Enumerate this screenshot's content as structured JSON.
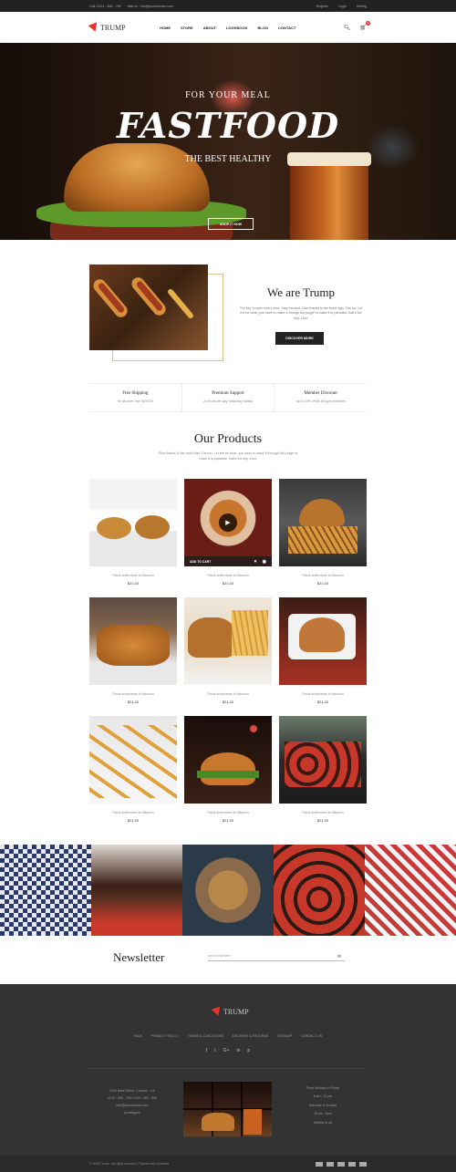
{
  "topbar": {
    "call": "Call: 0123 - 456 - 789",
    "mail": "Mail us : info@yourdomain.com",
    "links": [
      "Register",
      "Login",
      "Setting"
    ]
  },
  "header": {
    "logo_text": "TRUMP",
    "nav": [
      "HOME",
      "STORE",
      "ABOUT",
      "LOOKBOOK",
      "BLOG",
      "CONTACT"
    ],
    "cart_count": "0"
  },
  "hero": {
    "line1": "FOR YOUR MEAL",
    "line2": "FASTFOOD",
    "line3": "THE BEST HEALTHY",
    "button": "SHOP IT NOW"
  },
  "about": {
    "title": "We are Trump",
    "desc": "The key to open every door. Stay focused. Give thanks to the most high. Fan luv. Let me be clear, you have to make it through the jungle to make it to paradise, that's the key. Lion!",
    "button": "DISCOVER MORE"
  },
  "features": [
    {
      "title": "Free Shipping",
      "sub": "for all order over $099.00"
    },
    {
      "title": "Premium Support",
      "sub": "24 hours per day, including holiday"
    },
    {
      "title": "Member Discount",
      "sub": "Up to 20% off for all loyal members"
    }
  ],
  "products": {
    "title": "Our Products",
    "desc": "Give thanks to the most high. Fan luv. Let me be clear, you have to make it through the jungle to make it to paradise, that's the key. Lion!",
    "add_to_cart": "ADD TO CART",
    "items": [
      {
        "name": "Flank sollemnes in futurum",
        "price": "$21.00"
      },
      {
        "name": "Flank sollemnes in futurum",
        "price": "$21.00"
      },
      {
        "name": "Flank sollemnes in futurum",
        "price": "$21.00"
      },
      {
        "name": "Flank sollemnes in futurum",
        "price": "$21.00"
      },
      {
        "name": "Flank sollemnes in futurum",
        "price": "$21.00"
      },
      {
        "name": "Flank sollemnes in futurum",
        "price": "$21.00"
      },
      {
        "name": "Flank sollemnes in futurum",
        "price": "$21.00"
      },
      {
        "name": "Flank sollemnes in futurum",
        "price": "$21.00"
      },
      {
        "name": "Flank sollemnes in futurum",
        "price": "$21.00"
      }
    ]
  },
  "newsletter": {
    "title": "Newsletter",
    "placeholder": "your email here"
  },
  "footer": {
    "logo_text": "TRUMP",
    "links": [
      "FAQs",
      "PRIVACY POLICY",
      "TERMS & CONDITIONS",
      "DELIVERY & RETURNS",
      "SITEMAP",
      "CONTACT US"
    ],
    "social": [
      "f",
      "t",
      "G+",
      "in",
      "p"
    ],
    "address": [
      "2316 Bake Street - London - UK",
      "0123 - 456 - 789 / 0123 - 987 - 654",
      "info@yourdomain.com",
      "yourskype#"
    ],
    "hours": [
      "From Monday to Friday",
      "8 am - 10 pm",
      "Saturday & Sunday",
      "10 am - 8pm",
      "Holiday is off"
    ],
    "copyright": "© 2016 Trump - All rights reserved. Powered by Leotheme"
  },
  "colors": {
    "accent": "#e8322b",
    "dark": "#222222",
    "footer": "#333333"
  }
}
